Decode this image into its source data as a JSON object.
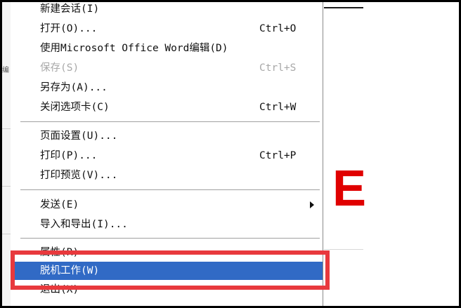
{
  "menu": {
    "items": [
      {
        "label": "新建会话(I)",
        "shortcut": ""
      },
      {
        "label": "打开(O)...",
        "shortcut": "Ctrl+O"
      },
      {
        "label": "使用Microsoft Office Word编辑(D)",
        "shortcut": ""
      },
      {
        "label": "保存(S)",
        "shortcut": "Ctrl+S"
      },
      {
        "label": "另存为(A)...",
        "shortcut": ""
      },
      {
        "label": "关闭选项卡(C)",
        "shortcut": "Ctrl+W"
      },
      {
        "label": "页面设置(U)...",
        "shortcut": ""
      },
      {
        "label": "打印(P)...",
        "shortcut": "Ctrl+P"
      },
      {
        "label": "打印预览(V)...",
        "shortcut": ""
      },
      {
        "label": "发送(E)",
        "shortcut": ""
      },
      {
        "label": "导入和导出(I)...",
        "shortcut": ""
      },
      {
        "label": "属性(R)",
        "shortcut": ""
      },
      {
        "label": "脱机工作(W)",
        "shortcut": ""
      },
      {
        "label": "退出(X)",
        "shortcut": ""
      }
    ]
  },
  "colors": {
    "selection": "#316ac5",
    "highlight_border": "#e8393d",
    "disabled_text": "#a8a8a8",
    "background_letter": "#e00000"
  },
  "background": {
    "letter": "E",
    "left_fragment": "编"
  },
  "icons": {
    "submenu": "triangle-right-icon"
  }
}
